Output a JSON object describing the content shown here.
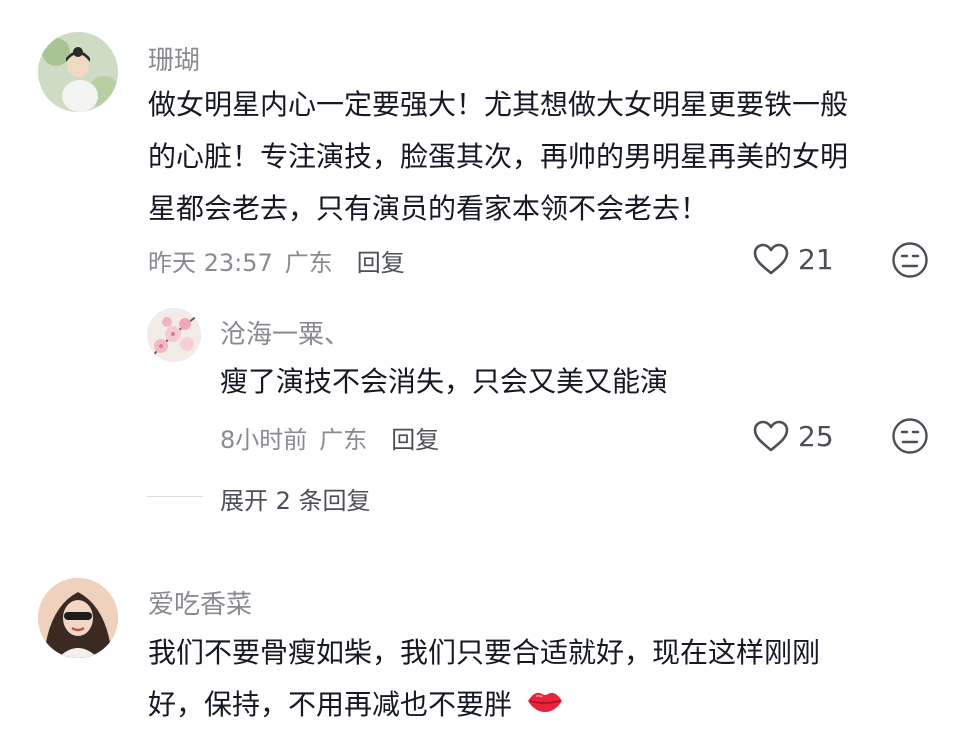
{
  "comments": [
    {
      "username": "珊瑚",
      "lines": [
        "做女明星内心一定要强大！尤其想做大女明星更要铁一般",
        "的心脏！专注演技，脸蛋其次，再帅的男明星再美的女明",
        "星都会老去，只有演员的看家本领不会老去！"
      ],
      "time": "昨天 23:57",
      "location": "广东",
      "reply_label": "回复",
      "likes": "21",
      "reply": {
        "username": "沧海一粟、",
        "text": "瘦了演技不会消失，只会又美又能演",
        "time": "8小时前",
        "location": "广东",
        "reply_label": "回复",
        "likes": "25"
      },
      "expand_label": "展开 2 条回复"
    },
    {
      "username": "爱吃香菜",
      "lines": [
        "我们不要骨瘦如柴，我们只要合适就好，现在这样刚刚",
        "好，保持，不用再减也不要胖"
      ]
    }
  ],
  "icons": {
    "like": "heart-outline-icon",
    "dislike": "neutral-face-icon",
    "emoji": "lips-emoji-icon"
  },
  "colors": {
    "text_primary": "#161823",
    "text_secondary": "#8a8b91",
    "action": "#4d4f57",
    "emoji_red": "#e8243c"
  }
}
